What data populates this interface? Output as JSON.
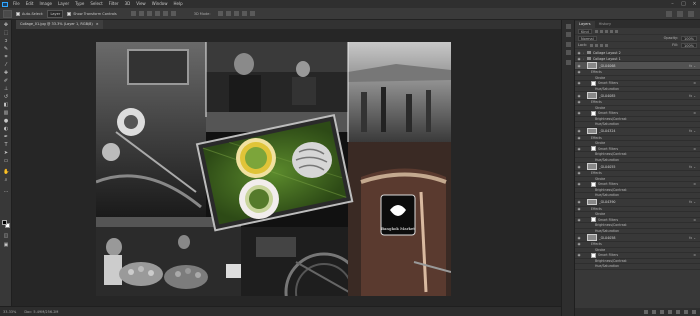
{
  "menubar": {
    "items": [
      "File",
      "Edit",
      "Image",
      "Layer",
      "Type",
      "Select",
      "Filter",
      "3D",
      "View",
      "Window",
      "Help"
    ],
    "window_controls": [
      "minimize-icon",
      "maximize-icon",
      "close-icon"
    ]
  },
  "options": {
    "auto_select_label": "Auto-Select:",
    "auto_select_target": "Layer",
    "show_transform_label": "Show Transform Controls",
    "mode_3d_label": "3D Mode:"
  },
  "document": {
    "tab_title": "Collage_01.jpg @ 33.3% (Layer 1, RGB/8)",
    "tab_close": "×"
  },
  "status": {
    "zoom": "33.33%",
    "doc_info": "Doc: 5.49M/256.2M"
  },
  "panel": {
    "tabs": [
      "Layers",
      "History"
    ],
    "kind_label": "Kind",
    "blend_mode": "Normal",
    "opacity_label": "Opacity:",
    "opacity_value": "100%",
    "lock_label": "Lock:",
    "fill_label": "Fill:",
    "fill_value": "100%",
    "layers": [
      {
        "kind": "group",
        "name": "Collage Layout 2",
        "depth": 0
      },
      {
        "kind": "group",
        "name": "Collage Layout 1",
        "depth": 0
      },
      {
        "kind": "photo",
        "name": "_GL04068",
        "depth": 1,
        "selected": true
      },
      {
        "kind": "sub",
        "name": "Effects",
        "depth": 2
      },
      {
        "kind": "sub",
        "name": "Stroke",
        "depth": 3
      },
      {
        "kind": "filter",
        "name": "Smart Filters",
        "depth": 2
      },
      {
        "kind": "sub",
        "name": "Hue/Saturation",
        "depth": 3
      },
      {
        "kind": "photo",
        "name": "_GL04085",
        "depth": 1
      },
      {
        "kind": "sub",
        "name": "Effects",
        "depth": 2
      },
      {
        "kind": "sub",
        "name": "Stroke",
        "depth": 3
      },
      {
        "kind": "filter",
        "name": "Smart Filters",
        "depth": 2
      },
      {
        "kind": "sub",
        "name": "Brightness/Contrast",
        "depth": 3
      },
      {
        "kind": "sub",
        "name": "Hue/Saturation",
        "depth": 3
      },
      {
        "kind": "photo",
        "name": "_GL04324",
        "depth": 1
      },
      {
        "kind": "sub",
        "name": "Effects",
        "depth": 2
      },
      {
        "kind": "sub",
        "name": "Stroke",
        "depth": 3
      },
      {
        "kind": "filter",
        "name": "Smart Filters",
        "depth": 2
      },
      {
        "kind": "sub",
        "name": "Brightness/Contrast",
        "depth": 3
      },
      {
        "kind": "sub",
        "name": "Hue/Saturation",
        "depth": 3
      },
      {
        "kind": "photo",
        "name": "_GL04055",
        "depth": 1
      },
      {
        "kind": "sub",
        "name": "Effects",
        "depth": 2
      },
      {
        "kind": "sub",
        "name": "Stroke",
        "depth": 3
      },
      {
        "kind": "filter",
        "name": "Smart Filters",
        "depth": 2
      },
      {
        "kind": "sub",
        "name": "Brightness/Contrast",
        "depth": 3
      },
      {
        "kind": "sub",
        "name": "Hue/Saturation",
        "depth": 3
      },
      {
        "kind": "photo",
        "name": "_GL04390",
        "depth": 1
      },
      {
        "kind": "sub",
        "name": "Effects",
        "depth": 2
      },
      {
        "kind": "sub",
        "name": "Stroke",
        "depth": 3
      },
      {
        "kind": "filter",
        "name": "Smart Filters",
        "depth": 2
      },
      {
        "kind": "sub",
        "name": "Brightness/Contrast",
        "depth": 3
      },
      {
        "kind": "sub",
        "name": "Hue/Saturation",
        "depth": 3
      },
      {
        "kind": "photo",
        "name": "_GL04058",
        "depth": 1
      },
      {
        "kind": "sub",
        "name": "Effects",
        "depth": 2
      },
      {
        "kind": "sub",
        "name": "Stroke",
        "depth": 3
      },
      {
        "kind": "filter",
        "name": "Smart Filters",
        "depth": 2
      },
      {
        "kind": "sub",
        "name": "Brightness/Contrast",
        "depth": 3
      },
      {
        "kind": "sub",
        "name": "Hue/Saturation",
        "depth": 3
      }
    ]
  },
  "canvas_art": {
    "logo_text": "Bangkok Market"
  },
  "colors": {
    "app_bg": "#262626",
    "panel_bg": "#383838",
    "selected_row": "#525252",
    "ps_accent": "#31a8ff"
  }
}
